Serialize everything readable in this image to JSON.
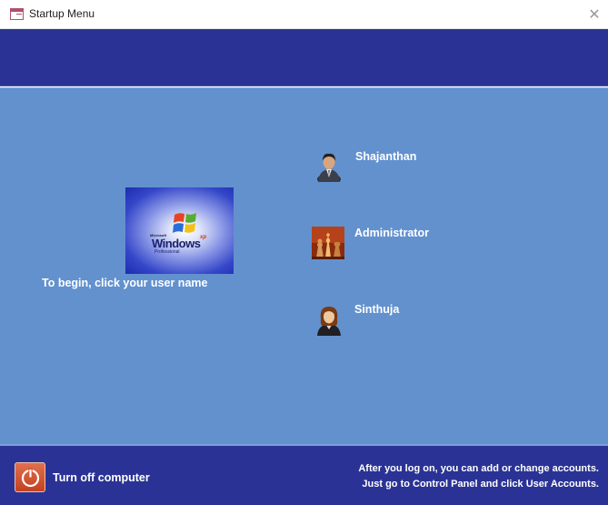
{
  "window": {
    "title": "Startup Menu",
    "close_glyph": "✕"
  },
  "logo": {
    "ms_text": "Microsoft",
    "brand": "Windows",
    "xp": "xp",
    "edition": "Professional"
  },
  "welcome": {
    "instruction": "To begin, click your user name"
  },
  "users": [
    {
      "name": "Shajanthan",
      "icon": "businessman-avatar-icon"
    },
    {
      "name": "Administrator",
      "icon": "chess-pieces-avatar-icon"
    },
    {
      "name": "Sinthuja",
      "icon": "woman-avatar-icon"
    }
  ],
  "footer": {
    "turn_off_label": "Turn off computer",
    "turn_off_icon": "power-icon",
    "info_line_1": "After you log on, you can add or change accounts.",
    "info_line_2": "Just go to Control Panel and click User Accounts."
  },
  "colors": {
    "band": "#2a3395",
    "main": "#6291ce",
    "power_button": "#d4552f"
  }
}
